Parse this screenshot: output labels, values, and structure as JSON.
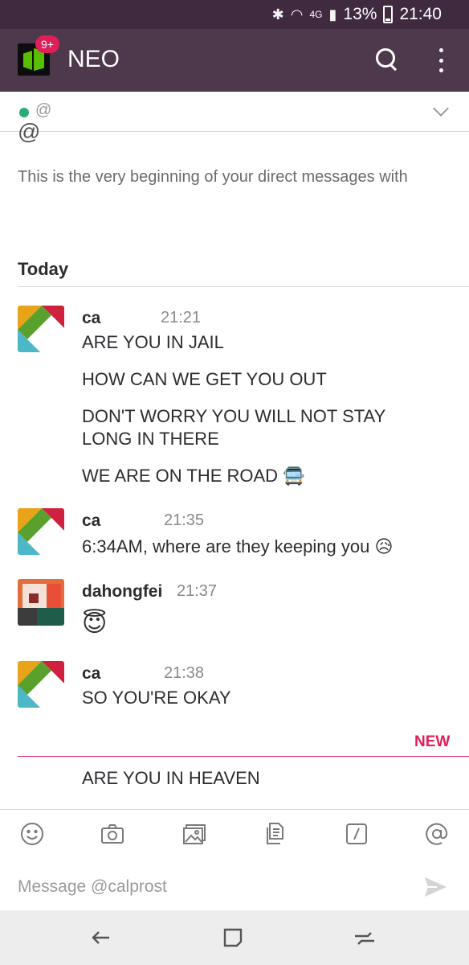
{
  "status_bar": {
    "signal_label": "4G",
    "battery": "13%",
    "time": "21:40"
  },
  "app_bar": {
    "badge": "9+",
    "workspace": "NEO"
  },
  "channel": {
    "name": "@"
  },
  "intro": {
    "handle": "@",
    "text": "This is the very beginning of your direct messages with"
  },
  "day_divider": {
    "label": "Today"
  },
  "messages": [
    {
      "author": "ca",
      "time": "21:21",
      "lines": [
        "ARE YOU IN JAIL",
        "HOW CAN WE GET YOU OUT",
        "DON'T WORRY YOU WILL NOT STAY LONG IN THERE",
        "WE ARE ON THE ROAD"
      ],
      "emoji": "🚍"
    },
    {
      "author": "ca",
      "time": "21:35",
      "lines": [
        "6:34AM, where are they keeping you"
      ],
      "emoji": "😥"
    },
    {
      "author": "dahongfei",
      "time": "21:37",
      "lines": [],
      "emoji": "😇"
    },
    {
      "author": "ca",
      "time": "21:38",
      "lines": [
        "SO YOU'RE OKAY"
      ]
    }
  ],
  "new_divider": {
    "label": "NEW"
  },
  "new_messages": [
    "ARE YOU IN HEAVEN"
  ],
  "composer": {
    "placeholder": "Message @calprost"
  },
  "colors": {
    "header_bg": "#4d394b",
    "status_bg": "#3f2a3f",
    "accent_new": "#e01e5a",
    "presence": "#2bac76"
  },
  "icons": [
    "bluetooth-icon",
    "wifi-icon",
    "signal-icon",
    "battery-icon",
    "search-icon",
    "more-vert-icon",
    "chevron-down-icon",
    "emoji-icon",
    "camera-icon",
    "gallery-icon",
    "file-icon",
    "slash-command-icon",
    "mention-icon",
    "send-icon",
    "back-icon",
    "home-icon",
    "recents-icon"
  ]
}
